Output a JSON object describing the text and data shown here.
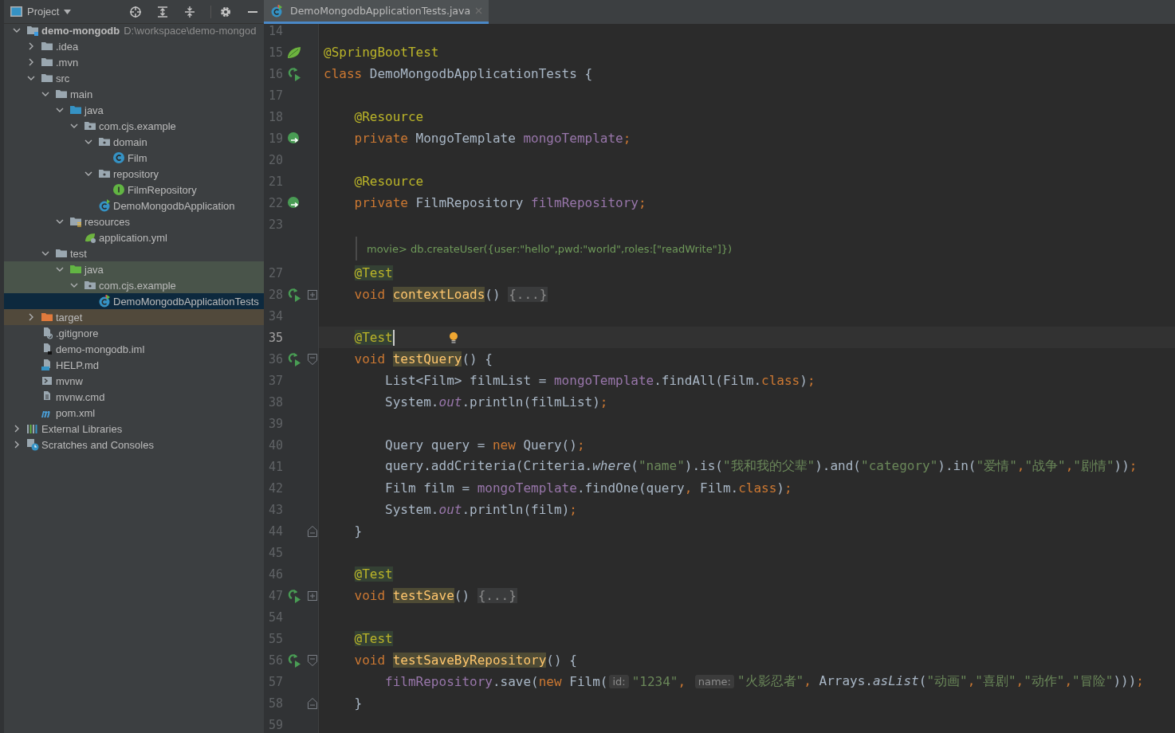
{
  "tool_window": {
    "title": "Project",
    "toolbar": [
      {
        "kind": "locate"
      },
      {
        "kind": "expand"
      },
      {
        "kind": "collapse"
      },
      {
        "kind": "settings"
      },
      {
        "kind": "hide"
      }
    ]
  },
  "project_tree": [
    {
      "label": "demo-mongodb",
      "path": "D:\\workspace\\demo-mongod",
      "kind": "module",
      "expanded": true,
      "selected": false,
      "children": [
        {
          "label": ".idea",
          "kind": "folder",
          "expanded": false,
          "selected": false
        },
        {
          "label": ".mvn",
          "kind": "folder",
          "expanded": false,
          "selected": false
        },
        {
          "label": "src",
          "kind": "folder",
          "expanded": true,
          "selected": false,
          "children": [
            {
              "label": "main",
              "kind": "folder",
              "expanded": true,
              "selected": false,
              "children": [
                {
                  "label": "java",
                  "kind": "source",
                  "expanded": true,
                  "selected": false,
                  "children": [
                    {
                      "label": "com.cjs.example",
                      "kind": "package",
                      "expanded": true,
                      "selected": false,
                      "children": [
                        {
                          "label": "domain",
                          "kind": "package",
                          "expanded": true,
                          "selected": false,
                          "children": [
                            {
                              "label": "Film",
                              "kind": "class",
                              "selected": false
                            }
                          ]
                        },
                        {
                          "label": "repository",
                          "kind": "package",
                          "expanded": true,
                          "selected": false,
                          "children": [
                            {
                              "label": "FilmRepository",
                              "kind": "interface",
                              "selected": false
                            }
                          ]
                        },
                        {
                          "label": "DemoMongodbApplication",
                          "kind": "app",
                          "selected": false
                        }
                      ]
                    }
                  ]
                },
                {
                  "label": "resources",
                  "kind": "resources",
                  "expanded": true,
                  "selected": false,
                  "children": [
                    {
                      "label": "application.yml",
                      "kind": "yml",
                      "selected": false
                    }
                  ]
                }
              ]
            },
            {
              "label": "test",
              "kind": "folder",
              "expanded": true,
              "selected": false,
              "children": [
                {
                  "label": "java",
                  "kind": "testsource",
                  "expanded": true,
                  "selected": false,
                  "test_scope": true,
                  "children": [
                    {
                      "label": "com.cjs.example",
                      "kind": "package",
                      "expanded": true,
                      "selected": false,
                      "test_scope": true,
                      "children": [
                        {
                          "label": "DemoMongodbApplicationTests",
                          "kind": "testclass",
                          "selected": true
                        }
                      ]
                    }
                  ]
                }
              ]
            }
          ]
        },
        {
          "label": "target",
          "kind": "excluded",
          "expanded": false,
          "selected": false,
          "excluded": true
        },
        {
          "label": ".gitignore",
          "kind": "ignore",
          "selected": false
        },
        {
          "label": "demo-mongodb.iml",
          "kind": "iml",
          "selected": false
        },
        {
          "label": "HELP.md",
          "kind": "markdown",
          "selected": false
        },
        {
          "label": "mvnw",
          "kind": "script",
          "selected": false
        },
        {
          "label": "mvnw.cmd",
          "kind": "text",
          "selected": false
        },
        {
          "label": "pom.xml",
          "kind": "maven",
          "selected": false
        }
      ]
    },
    {
      "label": "External Libraries",
      "kind": "libraries",
      "expanded": false,
      "selected": false
    },
    {
      "label": "Scratches and Consoles",
      "kind": "scratches",
      "expanded": false,
      "selected": false
    }
  ],
  "editor_tabs": [
    {
      "label": "DemoMongodbApplicationTests.java",
      "selected": true
    }
  ],
  "lines": [
    {
      "number": "14",
      "current": false
    },
    {
      "number": "15",
      "current": false,
      "gutter": {
        "kind": "spring"
      },
      "parts": [
        {
          "kind": "code",
          "tokens": [
            {
              "kind": "ann",
              "text": "@SpringBootTest"
            }
          ]
        }
      ]
    },
    {
      "number": "16",
      "current": false,
      "gutter": {
        "kind": "run"
      },
      "parts": [
        {
          "kind": "code",
          "tokens": [
            {
              "kind": "kw",
              "text": "class "
            },
            {
              "kind": "p",
              "text": "DemoMongodbApplicationTests {"
            }
          ]
        }
      ]
    },
    {
      "number": "17",
      "current": false
    },
    {
      "number": "18",
      "current": false,
      "parts": [
        {
          "kind": "code",
          "tokens": [
            {
              "kind": "ann",
              "text": "    @Resource"
            }
          ]
        }
      ]
    },
    {
      "number": "19",
      "current": false,
      "gutter": {
        "kind": "bean"
      },
      "parts": [
        {
          "kind": "code",
          "tokens": [
            {
              "kind": "kw",
              "text": "    private "
            },
            {
              "kind": "p",
              "text": "MongoTemplate "
            },
            {
              "kind": "fld",
              "text": "mongoTemplate"
            },
            {
              "kind": "kw",
              "text": ";"
            }
          ]
        }
      ]
    },
    {
      "number": "20",
      "current": false
    },
    {
      "number": "21",
      "current": false,
      "parts": [
        {
          "kind": "code",
          "tokens": [
            {
              "kind": "ann",
              "text": "    @Resource"
            }
          ]
        }
      ]
    },
    {
      "number": "22",
      "current": false,
      "gutter": {
        "kind": "bean"
      },
      "parts": [
        {
          "kind": "code",
          "tokens": [
            {
              "kind": "kw",
              "text": "    private "
            },
            {
              "kind": "p",
              "text": "FilmRepository "
            },
            {
              "kind": "fld",
              "text": "filmRepository"
            },
            {
              "kind": "kw",
              "text": ";"
            }
          ]
        }
      ]
    },
    {
      "number": "23",
      "current": false
    },
    {
      "kind": "doc",
      "text": "movie> db.createUser({user:\"hello\",pwd:\"world\",roles:[\"readWrite\"]})"
    },
    {
      "number": "27",
      "current": false,
      "parts": [
        {
          "kind": "code",
          "tokens": [
            {
              "kind": "ahl",
              "text": "    @Test"
            }
          ]
        }
      ]
    },
    {
      "number": "28",
      "current": false,
      "gutter": {
        "kind": "run"
      },
      "fold": {
        "kind": "collapsed"
      },
      "parts": [
        {
          "kind": "code",
          "tokens": [
            {
              "kind": "kw",
              "text": "    void "
            },
            {
              "kind": "mhl",
              "text": "contextLoads"
            },
            {
              "kind": "p",
              "text": "() "
            }
          ]
        },
        {
          "kind": "fold",
          "text": "{...}"
        }
      ]
    },
    {
      "number": "34",
      "current": false
    },
    {
      "number": "35",
      "current": true,
      "parts": [
        {
          "kind": "code",
          "tokens": [
            {
              "kind": "ahl",
              "text": "    @Test"
            }
          ]
        }
      ]
    },
    {
      "number": "36",
      "current": false,
      "gutter": {
        "kind": "run"
      },
      "fold": {
        "kind": "open"
      },
      "parts": [
        {
          "kind": "code",
          "tokens": [
            {
              "kind": "kw",
              "text": "    void "
            },
            {
              "kind": "mhl",
              "text": "testQuery"
            },
            {
              "kind": "p",
              "text": "() {"
            }
          ]
        }
      ]
    },
    {
      "number": "37",
      "current": false,
      "parts": [
        {
          "kind": "code",
          "tokens": [
            {
              "kind": "p",
              "text": "        List<Film> filmList = "
            },
            {
              "kind": "fld",
              "text": "mongoTemplate"
            },
            {
              "kind": "p",
              "text": ".findAll(Film."
            },
            {
              "kind": "kw",
              "text": "class"
            },
            {
              "kind": "p",
              "text": ")"
            },
            {
              "kind": "kw",
              "text": ";"
            }
          ]
        }
      ]
    },
    {
      "number": "38",
      "current": false,
      "parts": [
        {
          "kind": "code",
          "tokens": [
            {
              "kind": "p",
              "text": "        System."
            },
            {
              "kind": "sit",
              "text": "out"
            },
            {
              "kind": "p",
              "text": ".println(filmList)"
            },
            {
              "kind": "kw",
              "text": ";"
            }
          ]
        }
      ]
    },
    {
      "number": "39",
      "current": false
    },
    {
      "number": "40",
      "current": false,
      "parts": [
        {
          "kind": "code",
          "tokens": [
            {
              "kind": "p",
              "text": "        Query query = "
            },
            {
              "kind": "kw",
              "text": "new "
            },
            {
              "kind": "p",
              "text": "Query()"
            },
            {
              "kind": "kw",
              "text": ";"
            }
          ]
        }
      ]
    },
    {
      "number": "41",
      "current": false,
      "parts": [
        {
          "kind": "code",
          "tokens": [
            {
              "kind": "p",
              "text": "        query.addCriteria(Criteria."
            },
            {
              "kind": "it",
              "text": "where"
            },
            {
              "kind": "p",
              "text": "("
            },
            {
              "kind": "str",
              "text": "\"name\""
            },
            {
              "kind": "p",
              "text": ").is("
            },
            {
              "kind": "str",
              "text": "\"我和我的父辈\""
            },
            {
              "kind": "p",
              "text": ").and("
            },
            {
              "kind": "str",
              "text": "\"category\""
            },
            {
              "kind": "p",
              "text": ").in("
            },
            {
              "kind": "str",
              "text": "\"爱情\""
            },
            {
              "kind": "kw",
              "text": ","
            },
            {
              "kind": "str",
              "text": "\"战争\""
            },
            {
              "kind": "kw",
              "text": ","
            },
            {
              "kind": "str",
              "text": "\"剧情\""
            },
            {
              "kind": "p",
              "text": "))"
            },
            {
              "kind": "kw",
              "text": ";"
            }
          ]
        }
      ]
    },
    {
      "number": "42",
      "current": false,
      "parts": [
        {
          "kind": "code",
          "tokens": [
            {
              "kind": "p",
              "text": "        Film film = "
            },
            {
              "kind": "fld",
              "text": "mongoTemplate"
            },
            {
              "kind": "p",
              "text": ".findOne(query"
            },
            {
              "kind": "kw",
              "text": ", "
            },
            {
              "kind": "p",
              "text": "Film."
            },
            {
              "kind": "kw",
              "text": "class"
            },
            {
              "kind": "p",
              "text": ")"
            },
            {
              "kind": "kw",
              "text": ";"
            }
          ]
        }
      ]
    },
    {
      "number": "43",
      "current": false,
      "parts": [
        {
          "kind": "code",
          "tokens": [
            {
              "kind": "p",
              "text": "        System."
            },
            {
              "kind": "sit",
              "text": "out"
            },
            {
              "kind": "p",
              "text": ".println(film)"
            },
            {
              "kind": "kw",
              "text": ";"
            }
          ]
        }
      ]
    },
    {
      "number": "44",
      "current": false,
      "fold": {
        "kind": "close"
      },
      "parts": [
        {
          "kind": "code",
          "tokens": [
            {
              "kind": "p",
              "text": "    }"
            }
          ]
        }
      ]
    },
    {
      "number": "45",
      "current": false
    },
    {
      "number": "46",
      "current": false,
      "parts": [
        {
          "kind": "code",
          "tokens": [
            {
              "kind": "ahl",
              "text": "    @Test"
            }
          ]
        }
      ]
    },
    {
      "number": "47",
      "current": false,
      "gutter": {
        "kind": "run"
      },
      "fold": {
        "kind": "collapsed"
      },
      "parts": [
        {
          "kind": "code",
          "tokens": [
            {
              "kind": "kw",
              "text": "    void "
            },
            {
              "kind": "mhl",
              "text": "testSave"
            },
            {
              "kind": "p",
              "text": "() "
            }
          ]
        },
        {
          "kind": "fold",
          "text": "{...}"
        }
      ]
    },
    {
      "number": "54",
      "current": false
    },
    {
      "number": "55",
      "current": false,
      "parts": [
        {
          "kind": "code",
          "tokens": [
            {
              "kind": "ahl",
              "text": "    @Test"
            }
          ]
        }
      ]
    },
    {
      "number": "56",
      "current": false,
      "gutter": {
        "kind": "run"
      },
      "fold": {
        "kind": "open"
      },
      "parts": [
        {
          "kind": "code",
          "tokens": [
            {
              "kind": "kw",
              "text": "    void "
            },
            {
              "kind": "mhl",
              "text": "testSaveByRepository"
            },
            {
              "kind": "p",
              "text": "() {"
            }
          ]
        }
      ]
    },
    {
      "number": "57",
      "current": false,
      "parts": [
        {
          "kind": "code",
          "tokens": [
            {
              "kind": "fld",
              "text": "        filmRepository"
            },
            {
              "kind": "p",
              "text": ".save("
            },
            {
              "kind": "kw",
              "text": "new "
            },
            {
              "kind": "p",
              "text": "Film("
            }
          ]
        },
        {
          "kind": "hint",
          "text": "id:"
        },
        {
          "kind": "code",
          "tokens": [
            {
              "kind": "str",
              "text": "\"1234\""
            },
            {
              "kind": "kw",
              "text": ", "
            }
          ]
        },
        {
          "kind": "hint",
          "text": "name:"
        },
        {
          "kind": "code",
          "tokens": [
            {
              "kind": "str",
              "text": "\"火影忍者\""
            },
            {
              "kind": "kw",
              "text": ", "
            },
            {
              "kind": "p",
              "text": "Arrays."
            },
            {
              "kind": "it",
              "text": "asList"
            },
            {
              "kind": "p",
              "text": "("
            },
            {
              "kind": "str",
              "text": "\"动画\""
            },
            {
              "kind": "kw",
              "text": ","
            },
            {
              "kind": "str",
              "text": "\"喜剧\""
            },
            {
              "kind": "kw",
              "text": ","
            },
            {
              "kind": "str",
              "text": "\"动作\""
            },
            {
              "kind": "kw",
              "text": ","
            },
            {
              "kind": "str",
              "text": "\"冒险\""
            },
            {
              "kind": "p",
              "text": ")))"
            },
            {
              "kind": "kw",
              "text": ";"
            }
          ]
        }
      ]
    },
    {
      "number": "58",
      "current": false,
      "fold": {
        "kind": "close"
      },
      "parts": [
        {
          "kind": "code",
          "tokens": [
            {
              "kind": "p",
              "text": "    }"
            }
          ]
        }
      ]
    },
    {
      "number": "59",
      "current": false
    }
  ]
}
